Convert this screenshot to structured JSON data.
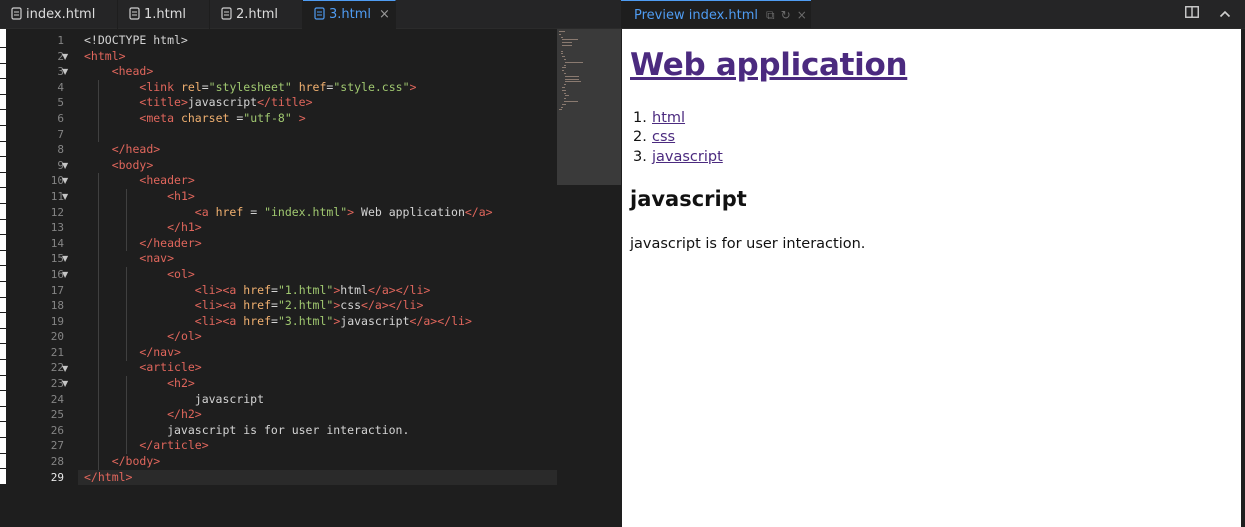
{
  "tabs": [
    {
      "label": "index.html",
      "active": false
    },
    {
      "label": "1.html",
      "active": false
    },
    {
      "label": "2.html",
      "active": false
    },
    {
      "label": "3.html",
      "active": true
    }
  ],
  "close_glyph": "×",
  "editor": {
    "line_numbers": [
      "1",
      "2",
      "3",
      "4",
      "5",
      "6",
      "7",
      "8",
      "9",
      "10",
      "11",
      "12",
      "13",
      "14",
      "15",
      "16",
      "17",
      "18",
      "19",
      "20",
      "21",
      "22",
      "23",
      "24",
      "25",
      "26",
      "27",
      "28",
      "29"
    ],
    "current_line": 29,
    "fold_lines": [
      2,
      3,
      9,
      10,
      11,
      15,
      16,
      22,
      23
    ],
    "lines": [
      "<!DOCTYPE html>",
      "<html>",
      "    <head>",
      "        <link rel=\"stylesheet\" href=\"style.css\">",
      "        <title>javascript</title>",
      "        <meta charset =\"utf-8\" >",
      "",
      "    </head>",
      "    <body>",
      "        <header>",
      "            <h1>",
      "                <a href = \"index.html\"> Web application</a>",
      "            </h1>",
      "        </header>",
      "        <nav>",
      "            <ol>",
      "                <li><a href=\"1.html\">html</a></li>",
      "                <li><a href=\"2.html\">css</a></li>",
      "                <li><a href=\"3.html\">javascript</a></li>",
      "            </ol>",
      "        </nav>",
      "        <article>",
      "            <h2>",
      "                javascript",
      "            </h2>",
      "            javascript is for user interaction.",
      "        </article>",
      "    </body>",
      "</html>"
    ]
  },
  "preview": {
    "tab_label": "Preview index.html",
    "h1": "Web application",
    "nav_items": [
      {
        "num": "1.",
        "label": "html"
      },
      {
        "num": "2.",
        "label": "css"
      },
      {
        "num": "3.",
        "label": "javascript"
      }
    ],
    "h2": "javascript",
    "paragraph": "javascript is for user interaction."
  },
  "colors": {
    "accent": "#4f9cf2",
    "tag": "#e0665c",
    "attr": "#f0b070",
    "string": "#a0c870",
    "link": "#4b2a7f"
  }
}
